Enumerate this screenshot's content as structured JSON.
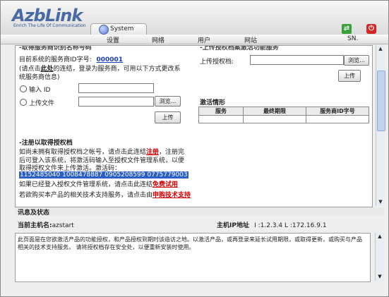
{
  "header": {
    "logo": "AzbLink",
    "tagline": "Enrich The Life Of Communication",
    "system_tab": "System",
    "icons": {
      "refresh": "refresh-icon",
      "power": "power-icon"
    }
  },
  "nav": {
    "items": [
      "设置",
      "网络",
      "用户",
      "网站",
      "SN."
    ]
  },
  "left": {
    "heading_cut": "-取得服务商识别名称号码",
    "vendor_id_label": "目前系统的服务商ID字号:",
    "vendor_id": "000001",
    "note_line1_a": "(请点击",
    "note_line1_link": "此处",
    "note_line1_b": "的连结，登录为服务商，可用以下方式更改系",
    "note_line2": "统服务商信息)",
    "input_id_label": "输入 ID",
    "upload_file_label": "上传文件",
    "browse": "浏览...",
    "upload": "上传",
    "register_title": "-注册以取得授权档",
    "reg_p1_a": "如尚未拥有取得授权档之帐号，请点击此连结",
    "reg_p1_link": "注册",
    "reg_p1_b": "，注册完",
    "reg_p2": "后可登入该系统，将激活码输入至授权文件管理系统，以便",
    "reg_p3": "取得授权文件来上传激活。激活码：",
    "activation_codes": "1152485040 1008478887 0905208599 0775779003",
    "reg_p4_a": "如果已经登入授权文件管理系统，请点击此连结",
    "reg_p4_link": "免费试用",
    "reg_p5_a": "若欲购买本产品的相关技术支持服务，请点击由",
    "reg_p5_link": "申购技术支持"
  },
  "right": {
    "heading_cut": "-上传授权档案激活功能服务",
    "upload_auth_label": "上传授权档:",
    "browse": "浏览...",
    "upload": "上传",
    "activation_title": "激活情形",
    "table_headers": [
      "服务",
      "最终期限",
      "服务商ID字号"
    ]
  },
  "info": {
    "title": "讯息及状态",
    "host_label": "当前主机名:",
    "host_name": "azstart",
    "ip_label": "主机IP地址",
    "ip_value": "I :1.2.3.4   L :172.16.9.1",
    "message": "此页面是在您欲激活产品的功能授权，和产品授权到期时该造访之地。以激活产品，或再登录来延长试用期限，或取得更新，或购买与产品相关的技术支持服务。 请将授权档存在安全处，以便重新安装时使用。"
  },
  "colors": {
    "accent": "#2b5fc4",
    "link": "#1a3fb3",
    "alert": "#d40000",
    "brand": "#4a6aa3"
  }
}
